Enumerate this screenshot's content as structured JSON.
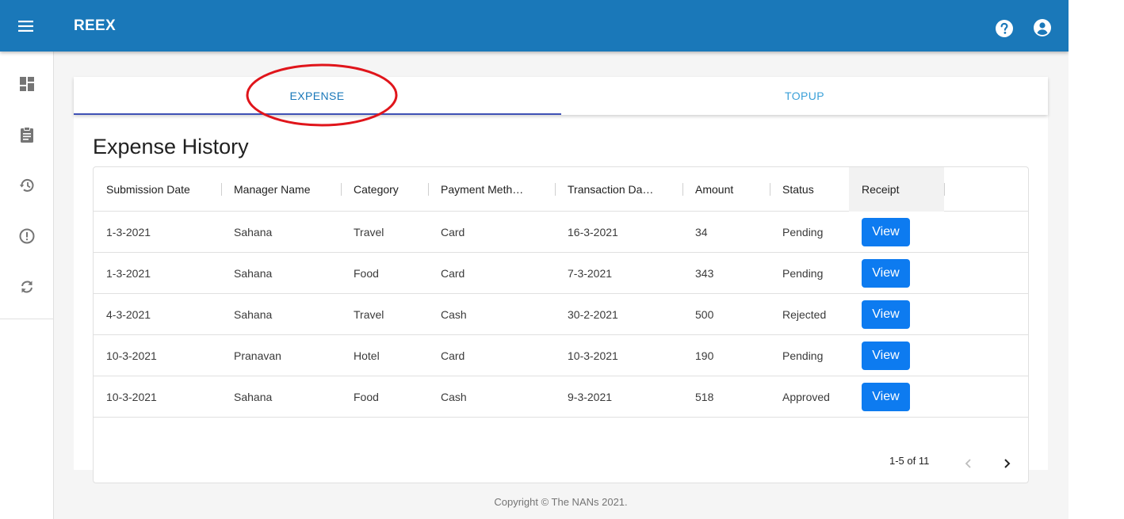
{
  "app": {
    "title": "REEX"
  },
  "tabs": [
    {
      "label": "EXPENSE",
      "selected": true
    },
    {
      "label": "TOPUP",
      "selected": false
    }
  ],
  "page": {
    "title": "Expense History"
  },
  "table": {
    "columns": [
      "Submission Date",
      "Manager Name",
      "Category",
      "Payment Meth…",
      "Transaction Da…",
      "Amount",
      "Status",
      "Receipt"
    ],
    "rows": [
      {
        "submission_date": "1-3-2021",
        "manager": "Sahana",
        "category": "Travel",
        "payment": "Card",
        "transaction_date": "16-3-2021",
        "amount": "34",
        "status": "Pending",
        "receipt": "View"
      },
      {
        "submission_date": "1-3-2021",
        "manager": "Sahana",
        "category": "Food",
        "payment": "Card",
        "transaction_date": "7-3-2021",
        "amount": "343",
        "status": "Pending",
        "receipt": "View"
      },
      {
        "submission_date": "4-3-2021",
        "manager": "Sahana",
        "category": "Travel",
        "payment": "Cash",
        "transaction_date": "30-2-2021",
        "amount": "500",
        "status": "Rejected",
        "receipt": "View"
      },
      {
        "submission_date": "10-3-2021",
        "manager": "Pranavan",
        "category": "Hotel",
        "payment": "Card",
        "transaction_date": "10-3-2021",
        "amount": "190",
        "status": "Pending",
        "receipt": "View"
      },
      {
        "submission_date": "10-3-2021",
        "manager": "Sahana",
        "category": "Food",
        "payment": "Cash",
        "transaction_date": "9-3-2021",
        "amount": "518",
        "status": "Approved",
        "receipt": "View"
      }
    ]
  },
  "pagination": {
    "label": "1-5 of 11"
  },
  "footer": {
    "text": "Copyright © The NANs 2021."
  },
  "icons": {
    "menu": "menu-icon",
    "help": "help-icon",
    "account": "account-circle-icon",
    "sidebar": [
      "dashboard-icon",
      "assignment-icon",
      "history-icon",
      "error-outline-icon",
      "sync-icon"
    ],
    "prev": "chevron-left-icon",
    "next": "chevron-right-icon"
  },
  "colors": {
    "appbar": "#1a78b9",
    "tab_active": "#1a78b9",
    "tab_inactive": "#3aa0d8",
    "tab_indicator": "#3f51b5",
    "view_button": "#0d7bf0",
    "annotation": "#e0151b"
  }
}
